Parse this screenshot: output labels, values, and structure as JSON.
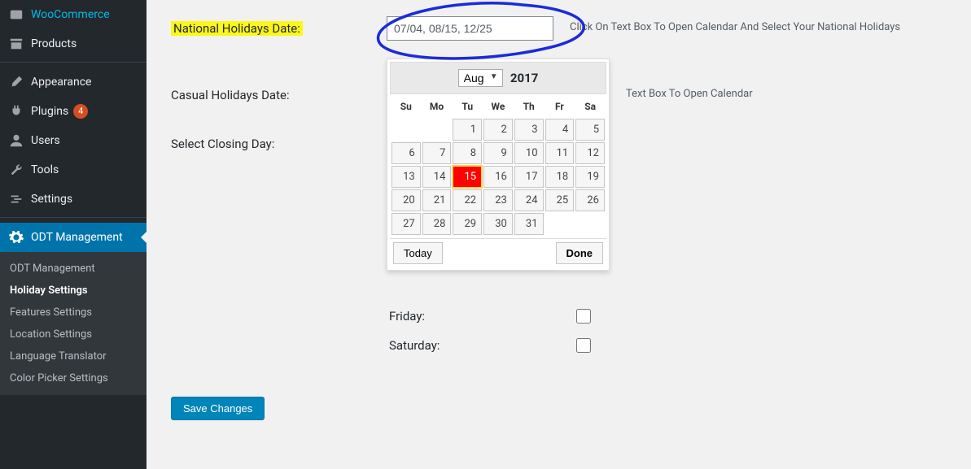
{
  "sidebar": {
    "items": [
      {
        "label": "WooCommerce"
      },
      {
        "label": "Products"
      },
      {
        "label": "Appearance"
      },
      {
        "label": "Plugins",
        "badge": "4"
      },
      {
        "label": "Users"
      },
      {
        "label": "Tools"
      },
      {
        "label": "Settings"
      },
      {
        "label": "ODT Management"
      }
    ],
    "submenu": [
      {
        "label": "ODT Management"
      },
      {
        "label": "Holiday Settings"
      },
      {
        "label": "Features Settings"
      },
      {
        "label": "Location Settings"
      },
      {
        "label": "Language Translator"
      },
      {
        "label": "Color Picker Settings"
      }
    ]
  },
  "form": {
    "national_label": "National Holidays Date:",
    "national_value": "07/04, 08/15, 12/25",
    "national_hint": "Click On Text Box To Open Calendar And Select Your National Holidays",
    "casual_label": "Casual Holidays Date:",
    "casual_hint": "Text Box To Open Calendar",
    "closing_label": "Select Closing Day:",
    "closing_days": {
      "friday": "Friday:",
      "saturday": "Saturday:"
    },
    "save": "Save Changes"
  },
  "datepicker": {
    "month": "Aug",
    "year": "2017",
    "dow": [
      "Su",
      "Mo",
      "Tu",
      "We",
      "Th",
      "Fr",
      "Sa"
    ],
    "days": [
      [
        "",
        "",
        1,
        2,
        3,
        4,
        5
      ],
      [
        6,
        7,
        8,
        9,
        10,
        11,
        12
      ],
      [
        13,
        14,
        15,
        16,
        17,
        18,
        19
      ],
      [
        20,
        21,
        22,
        23,
        24,
        25,
        26
      ],
      [
        27,
        28,
        29,
        30,
        31,
        "",
        ""
      ]
    ],
    "selected": 15,
    "today": "Today",
    "done": "Done"
  }
}
